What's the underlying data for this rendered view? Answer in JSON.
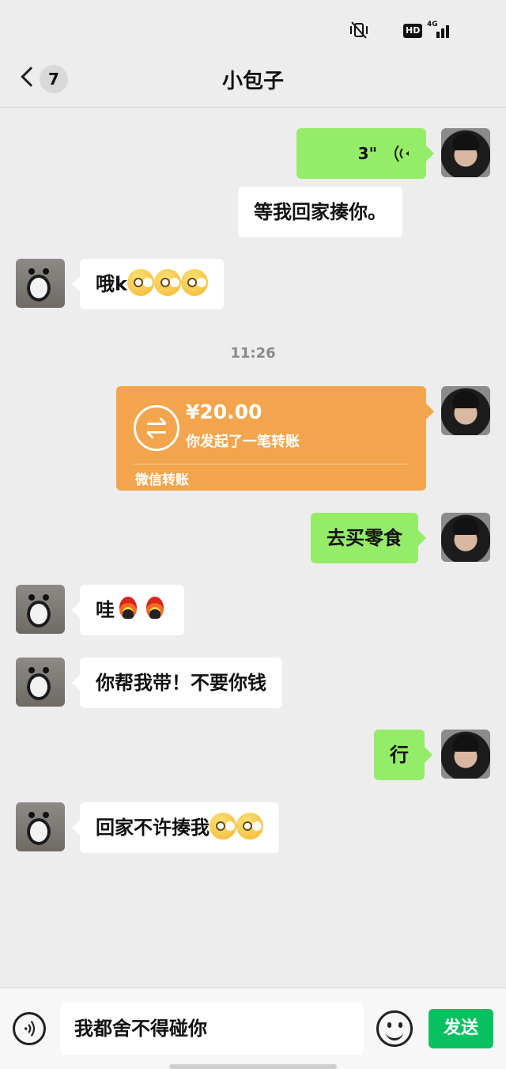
{
  "status_bar": {
    "hd_label": "HD",
    "network_label": "4G",
    "icons": [
      "vibrate-mute-icon",
      "hd-icon",
      "signal-icon"
    ]
  },
  "header": {
    "back_icon": "chevron-left-icon",
    "unread_count": "7",
    "title": "小包子"
  },
  "messages": [
    {
      "side": "me",
      "type": "voice",
      "duration": "3\"",
      "icon": "voice-wave-icon"
    },
    {
      "side": "me",
      "type": "text",
      "text": "等我回家揍你。"
    },
    {
      "side": "other",
      "type": "text",
      "text": "哦k",
      "emojis": [
        "salute-face",
        "salute-face",
        "salute-face"
      ]
    },
    {
      "type": "time",
      "text": "11:26"
    },
    {
      "side": "me",
      "type": "transfer",
      "amount": "¥20.00",
      "desc": "你发起了一笔转账",
      "footer": "微信转账",
      "icon": "transfer-arrows-icon"
    },
    {
      "side": "me",
      "type": "text",
      "text": "去买零食"
    },
    {
      "side": "other",
      "type": "text",
      "text": "哇",
      "emojis": [
        "fire-penguin",
        "fire-penguin"
      ]
    },
    {
      "side": "other",
      "type": "text",
      "text": "你帮我带！不要你钱"
    },
    {
      "side": "me",
      "type": "text",
      "text": "行"
    },
    {
      "side": "other",
      "type": "text",
      "text": "回家不许揍我",
      "emojis": [
        "salute-face",
        "salute-face"
      ]
    }
  ],
  "input_bar": {
    "voice_icon": "voice-mode-icon",
    "input_value": "我都舍不得碰你",
    "emoji_icon": "emoji-icon",
    "send_label": "发送"
  },
  "colors": {
    "background": "#ededed",
    "my_bubble": "#95ec69",
    "their_bubble": "#ffffff",
    "transfer_card": "#f2a54d",
    "send_button": "#07c160"
  }
}
